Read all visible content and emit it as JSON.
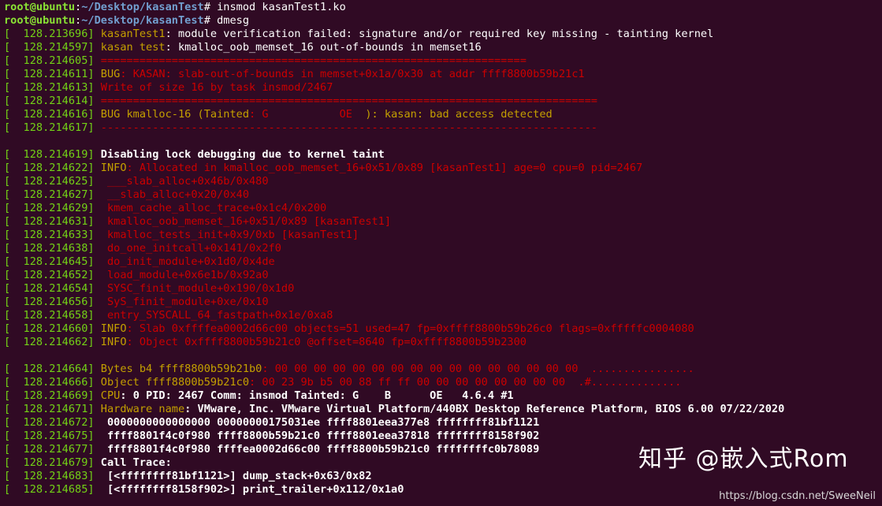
{
  "prompt": {
    "user": "root@ubuntu",
    "sep": ":",
    "path": "~/Desktop/kasanTest",
    "hash": "# "
  },
  "commands": [
    "insmod kasanTest1.ko",
    "dmesg"
  ],
  "log": [
    {
      "ts": "[  128.213696] ",
      "parts": [
        {
          "t": "kasanTest1",
          "c": "y"
        },
        {
          "t": ": module verification failed: signature and/or required key missing - tainting kernel",
          "c": "w"
        }
      ]
    },
    {
      "ts": "[  128.214597] ",
      "parts": [
        {
          "t": "kasan test",
          "c": "y"
        },
        {
          "t": ": kmalloc_oob_memset_16 out-of-bounds in memset16",
          "c": "w"
        }
      ]
    },
    {
      "ts": "[  128.214605] ",
      "parts": [
        {
          "t": "==================================================================",
          "c": "r"
        }
      ]
    },
    {
      "ts": "[  128.214611] ",
      "parts": [
        {
          "t": "BUG",
          "c": "y"
        },
        {
          "t": ": KASAN: slab-out-of-bounds in memset+0x1a/0x30 at addr ffff8800b59b21c1",
          "c": "r"
        }
      ]
    },
    {
      "ts": "[  128.214613] ",
      "parts": [
        {
          "t": "Write of size 16 by task insmod/2467",
          "c": "r"
        }
      ]
    },
    {
      "ts": "[  128.214614] ",
      "parts": [
        {
          "t": "=============================================================================",
          "c": "r"
        }
      ]
    },
    {
      "ts": "[  128.214616] ",
      "parts": [
        {
          "t": "BUG kmalloc-16 (Tainted",
          "c": "y"
        },
        {
          "t": ": G           OE  ",
          "c": "r"
        },
        {
          "t": "): kasan: bad access detected",
          "c": "y"
        }
      ]
    },
    {
      "ts": "[  128.214617] ",
      "parts": [
        {
          "t": "-----------------------------------------------------------------------------",
          "c": "r"
        }
      ]
    },
    {
      "ts": "",
      "parts": [
        {
          "t": "",
          "c": "w"
        }
      ]
    },
    {
      "ts": "[  128.214619] ",
      "parts": [
        {
          "t": "Disabling lock debugging due to kernel taint",
          "c": "wb"
        }
      ]
    },
    {
      "ts": "[  128.214622] ",
      "parts": [
        {
          "t": "INFO",
          "c": "y"
        },
        {
          "t": ": Allocated in kmalloc_oob_memset_16+0x51/0x89 [kasanTest1] age=0 cpu=0 pid=2467",
          "c": "r"
        }
      ]
    },
    {
      "ts": "[  128.214625] ",
      "parts": [
        {
          "t": " ___slab_alloc+0x46b/0x480",
          "c": "r"
        }
      ]
    },
    {
      "ts": "[  128.214627] ",
      "parts": [
        {
          "t": " __slab_alloc+0x20/0x40",
          "c": "r"
        }
      ]
    },
    {
      "ts": "[  128.214629] ",
      "parts": [
        {
          "t": " kmem_cache_alloc_trace+0x1c4/0x200",
          "c": "r"
        }
      ]
    },
    {
      "ts": "[  128.214631] ",
      "parts": [
        {
          "t": " kmalloc_oob_memset_16+0x51/0x89 [kasanTest1]",
          "c": "r"
        }
      ]
    },
    {
      "ts": "[  128.214633] ",
      "parts": [
        {
          "t": " kmalloc_tests_init+0x9/0xb [kasanTest1]",
          "c": "r"
        }
      ]
    },
    {
      "ts": "[  128.214638] ",
      "parts": [
        {
          "t": " do_one_initcall+0x141/0x2f0",
          "c": "r"
        }
      ]
    },
    {
      "ts": "[  128.214645] ",
      "parts": [
        {
          "t": " do_init_module+0x1d0/0x4de",
          "c": "r"
        }
      ]
    },
    {
      "ts": "[  128.214652] ",
      "parts": [
        {
          "t": " load_module+0x6e1b/0x92a0",
          "c": "r"
        }
      ]
    },
    {
      "ts": "[  128.214654] ",
      "parts": [
        {
          "t": " SYSC_finit_module+0x190/0x1d0",
          "c": "r"
        }
      ]
    },
    {
      "ts": "[  128.214656] ",
      "parts": [
        {
          "t": " SyS_finit_module+0xe/0x10",
          "c": "r"
        }
      ]
    },
    {
      "ts": "[  128.214658] ",
      "parts": [
        {
          "t": " entry_SYSCALL_64_fastpath+0x1e/0xa8",
          "c": "r"
        }
      ]
    },
    {
      "ts": "[  128.214660] ",
      "parts": [
        {
          "t": "INFO",
          "c": "y"
        },
        {
          "t": ": Slab 0xffffea0002d66c00 objects=51 used=47 fp=0xffff8800b59b26c0 flags=0xfffffc0004080",
          "c": "r"
        }
      ]
    },
    {
      "ts": "[  128.214662] ",
      "parts": [
        {
          "t": "INFO",
          "c": "y"
        },
        {
          "t": ": Object 0xffff8800b59b21c0 @offset=8640 fp=0xffff8800b59b2300",
          "c": "r"
        }
      ]
    },
    {
      "ts": "",
      "parts": [
        {
          "t": "",
          "c": "w"
        }
      ]
    },
    {
      "ts": "[  128.214664] ",
      "parts": [
        {
          "t": "Bytes b4 ffff8800b59b21b0",
          "c": "y"
        },
        {
          "t": ": 00 00 00 00 00 00 00 00 00 00 00 00 00 00 00 00  ................",
          "c": "r"
        }
      ]
    },
    {
      "ts": "[  128.214666] ",
      "parts": [
        {
          "t": "Object ffff8800b59b21c0",
          "c": "y"
        },
        {
          "t": ": 00 23 9b b5 00 88 ff ff 00 00 00 00 00 00 00 00  .#..............",
          "c": "r"
        }
      ]
    },
    {
      "ts": "[  128.214669] ",
      "parts": [
        {
          "t": "CPU",
          "c": "y"
        },
        {
          "t": ": 0 PID: 2467 Comm: insmod Tainted: G    B      OE   4.6.4 #1",
          "c": "wb"
        }
      ]
    },
    {
      "ts": "[  128.214671] ",
      "parts": [
        {
          "t": "Hardware name",
          "c": "y"
        },
        {
          "t": ": VMware, Inc. VMware Virtual Platform/440BX Desktop Reference Platform, BIOS 6.00 07/22/2020",
          "c": "wb"
        }
      ]
    },
    {
      "ts": "[  128.214672] ",
      "parts": [
        {
          "t": " 0000000000000000 00000000175031ee ffff8801eea377e8 ffffffff81bf1121",
          "c": "wb"
        }
      ]
    },
    {
      "ts": "[  128.214675] ",
      "parts": [
        {
          "t": " ffff8801f4c0f980 ffff8800b59b21c0 ffff8801eea37818 ffffffff8158f902",
          "c": "wb"
        }
      ]
    },
    {
      "ts": "[  128.214677] ",
      "parts": [
        {
          "t": " ffff8801f4c0f980 ffffea0002d66c00 ffff8800b59b21c0 ffffffffc0b78089",
          "c": "wb"
        }
      ]
    },
    {
      "ts": "[  128.214679] ",
      "parts": [
        {
          "t": "Call Trace:",
          "c": "wb"
        }
      ]
    },
    {
      "ts": "[  128.214683] ",
      "parts": [
        {
          "t": " [<ffffffff81bf1121>] dump_stack+0x63/0x82",
          "c": "wb"
        }
      ]
    },
    {
      "ts": "[  128.214685] ",
      "parts": [
        {
          "t": " [<ffffffff8158f902>] print_trailer+0x112/0x1a0",
          "c": "wb"
        }
      ]
    }
  ],
  "watermark": "知乎 @嵌入式Rom",
  "source_url": "https://blog.csdn.net/SweeNeil"
}
